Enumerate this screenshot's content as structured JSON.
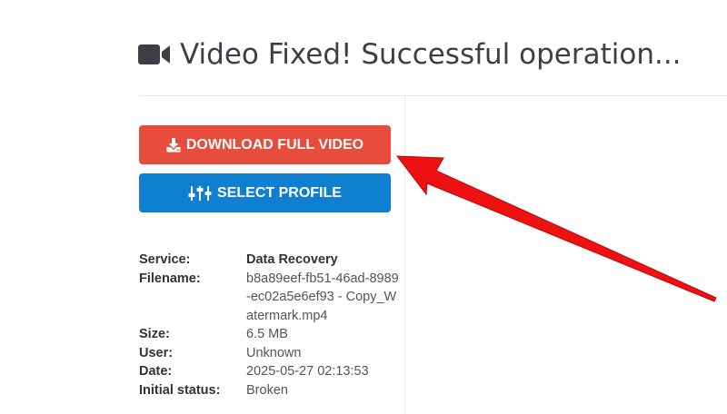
{
  "page": {
    "title": "Video Fixed! Successful operation...",
    "title_icon": "video-camera-icon"
  },
  "buttons": {
    "download": {
      "label": "DOWNLOAD FULL VIDEO",
      "icon": "download-icon",
      "color": "#e74c3c"
    },
    "profile": {
      "label": "SELECT PROFILE",
      "icon": "sliders-icon",
      "color": "#0f7fd2"
    }
  },
  "details": {
    "service": {
      "label": "Service:",
      "value": "Data Recovery"
    },
    "filename": {
      "label": "Filename:",
      "value": "b8a89eef-fb51-46ad-8989-ec02a5e6ef93 - Copy_Watermark.mp4"
    },
    "size": {
      "label": "Size:",
      "value": "6.5 MB"
    },
    "user": {
      "label": "User:",
      "value": "Unknown"
    },
    "date": {
      "label": "Date:",
      "value": "2025-05-27 02:13:53"
    },
    "initial_status": {
      "label": "Initial status:",
      "value": "Broken"
    }
  },
  "annotation": {
    "arrow_color": "#ee1111"
  }
}
